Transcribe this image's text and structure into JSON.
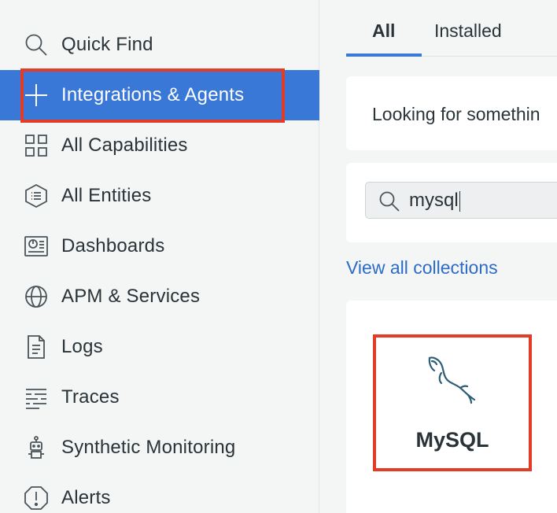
{
  "sidebar": {
    "items": [
      {
        "label": "Quick Find",
        "icon": "search-icon",
        "active": false
      },
      {
        "label": "Integrations & Agents",
        "icon": "plus-icon",
        "active": true
      },
      {
        "label": "All Capabilities",
        "icon": "grid-icon",
        "active": false
      },
      {
        "label": "All Entities",
        "icon": "entities-icon",
        "active": false
      },
      {
        "label": "Dashboards",
        "icon": "dashboard-icon",
        "active": false
      },
      {
        "label": "APM & Services",
        "icon": "globe-icon",
        "active": false
      },
      {
        "label": "Logs",
        "icon": "document-icon",
        "active": false
      },
      {
        "label": "Traces",
        "icon": "traces-icon",
        "active": false
      },
      {
        "label": "Synthetic Monitoring",
        "icon": "robot-icon",
        "active": false
      },
      {
        "label": "Alerts",
        "icon": "alert-icon",
        "active": false
      }
    ]
  },
  "main": {
    "tabs": [
      {
        "label": "All",
        "active": true
      },
      {
        "label": "Installed",
        "active": false
      }
    ],
    "banner_text": "Looking for somethin",
    "search": {
      "value": "mysql",
      "icon": "search-icon"
    },
    "view_all_link": "View all collections",
    "tile": {
      "name": "MySQL",
      "icon": "mysql-dolphin-icon"
    }
  },
  "colors": {
    "accent": "#3a78d8",
    "highlight": "#e03c27",
    "link": "#2c6cc6",
    "sidebar_bg": "#f4f5f5"
  }
}
